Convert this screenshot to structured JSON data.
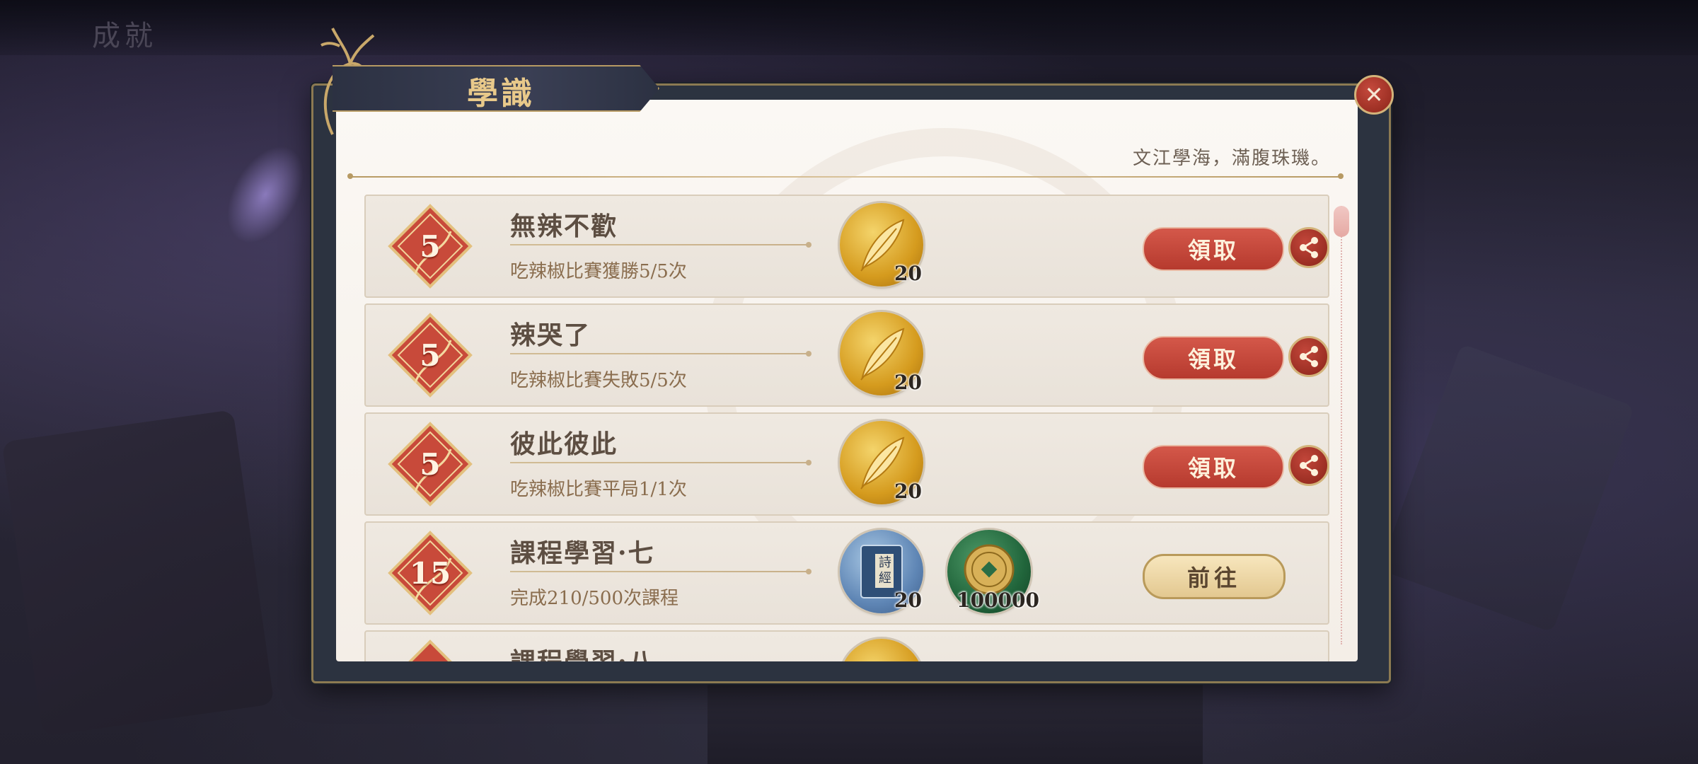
{
  "background": {
    "title": "成就"
  },
  "dialog": {
    "title": "學識",
    "subtitle": "文江學海，滿腹珠璣。",
    "close_icon": "close-icon"
  },
  "tasks": [
    {
      "badge": "5",
      "title": "無辣不歡",
      "desc": "吃辣椒比賽獲勝5/5次",
      "rewards": [
        {
          "icon": "feather-icon",
          "count": "20"
        }
      ],
      "action": "領取",
      "action_type": "claim"
    },
    {
      "badge": "5",
      "title": "辣哭了",
      "desc": "吃辣椒比賽失敗5/5次",
      "rewards": [
        {
          "icon": "feather-icon",
          "count": "20"
        }
      ],
      "action": "領取",
      "action_type": "claim"
    },
    {
      "badge": "5",
      "title": "彼此彼此",
      "desc": "吃辣椒比賽平局1/1次",
      "rewards": [
        {
          "icon": "feather-icon",
          "count": "20"
        }
      ],
      "action": "領取",
      "action_type": "claim"
    },
    {
      "badge": "15",
      "title": "課程學習·七",
      "desc": "完成210/500次課程",
      "rewards": [
        {
          "icon": "poetry-book-icon",
          "label": "詩經",
          "count": "20"
        },
        {
          "icon": "coin-icon",
          "count": "100000"
        }
      ],
      "action": "前往",
      "action_type": "go"
    },
    {
      "badge": "",
      "title": "課程學習·八",
      "desc": "",
      "rewards": [
        {
          "icon": "feather-icon",
          "count": ""
        }
      ],
      "action": "",
      "action_type": "none"
    }
  ]
}
